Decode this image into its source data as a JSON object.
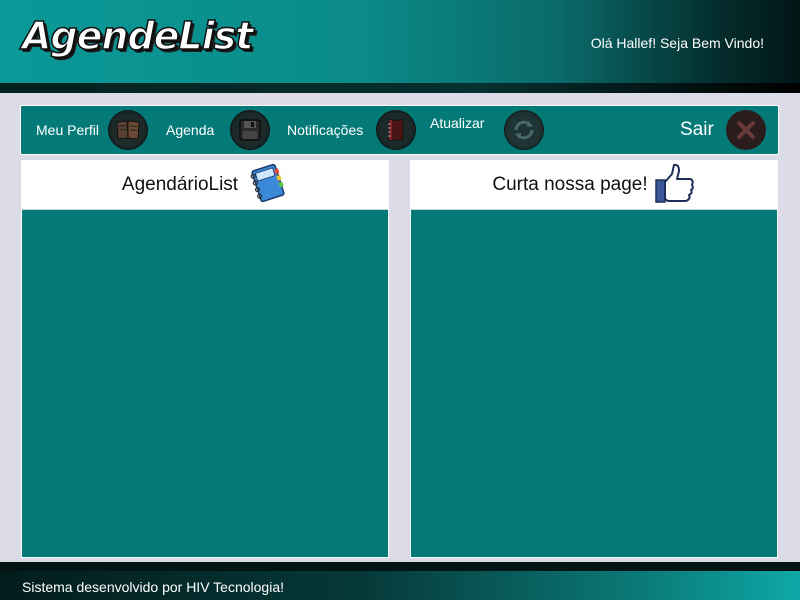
{
  "header": {
    "logo_text": "AgendeList",
    "greeting": "Olá Hallef! Seja Bem Vindo!"
  },
  "toolbar": {
    "items": [
      {
        "label": "Meu Perfil",
        "icon": "book-icon"
      },
      {
        "label": "Agenda",
        "icon": "floppy-disk-icon"
      },
      {
        "label": "Notificações",
        "icon": "notebook-icon"
      },
      {
        "label": "Atualizar",
        "icon": "refresh-icon"
      }
    ],
    "logout": {
      "label": "Sair",
      "icon": "close-icon"
    }
  },
  "panels": {
    "left": {
      "title": "AgendárioList",
      "icon": "address-book-icon"
    },
    "right": {
      "title": "Curta nossa page!",
      "icon": "thumbs-up-icon"
    }
  },
  "footer": {
    "text": "Sistema desenvolvido por HIV Tecnologia!"
  },
  "colors": {
    "primary_teal": "#047a78",
    "background": "#dcdce8",
    "logout_accent": "#8a2a2a",
    "thumb_blue": "#3b5998"
  }
}
